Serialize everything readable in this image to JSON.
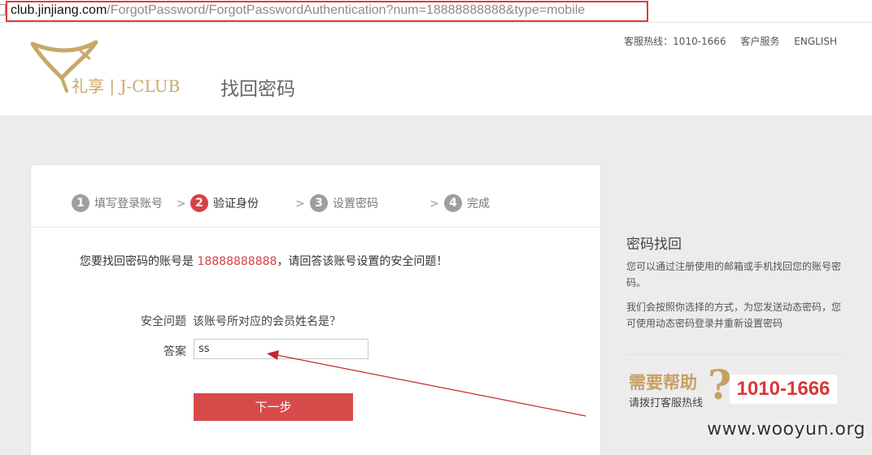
{
  "browser": {
    "url_domain": "club.jinjiang.com",
    "url_path": "/ForgotPassword/ForgotPasswordAuthentication?num=18888888888&type=mobile"
  },
  "header": {
    "logo_text": "礼享 | J-CLUB",
    "page_title": "找回密码",
    "hotline": "客服热线：1010-1666",
    "customer_service": "客户服务",
    "english": "ENGLISH"
  },
  "steps": [
    {
      "num": "1",
      "label": "填写登录账号",
      "state": "done"
    },
    {
      "num": "2",
      "label": "验证身份",
      "state": "active"
    },
    {
      "num": "3",
      "label": "设置密码",
      "state": "todo"
    },
    {
      "num": "4",
      "label": "完成",
      "state": "todo"
    }
  ],
  "step_separator": ">",
  "form": {
    "notice_prefix": "您要找回密码的账号是",
    "account": "18888888888",
    "notice_suffix": "，请回答该账号设置的安全问题！",
    "question_label": "安全问题",
    "question_text": "该账号所对应的会员姓名是？",
    "answer_label": "答案",
    "answer_value": "ss",
    "next_button": "下一步"
  },
  "sidebar": {
    "title": "密码找回",
    "para1": "您可以通过注册使用的邮箱或手机找回您的账号密码。",
    "para2": "我们会按照你选择的方式，为您发送动态密码，您可使用动态密码登录并重新设置密码",
    "help_big": "需要帮助",
    "help_small": "请拨打客服热线",
    "help_q": "?",
    "help_phone": "1010-1666"
  },
  "watermark": "www.wooyun.org",
  "colors": {
    "accent_red": "#d84141",
    "gold": "#c8a064",
    "url_highlight": "#e53935"
  }
}
